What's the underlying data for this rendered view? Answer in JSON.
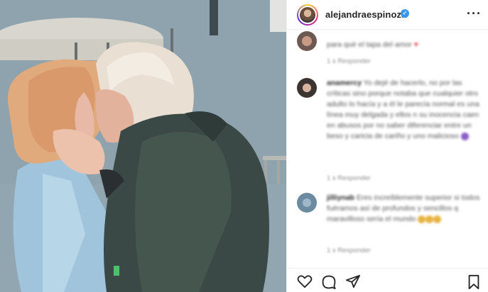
{
  "post": {
    "username": "alejandraespinoza",
    "verified": true,
    "more_icon": "more-horizontal-icon"
  },
  "comments": [
    {
      "text": "para qué el tapa del amor",
      "emoji_after": "heart",
      "meta": "1 s   Responder"
    },
    {
      "username": "anamercy",
      "text": "Yo dejé de hacerlo, no por las críticas sino porque notaba que cualquier otro adulto lo hacía y a él le parecía normal  es una línea muy delgada y ellos n su inocencia caen en abusos por no saber diferenciar entre un beso y caricia de cariño y uno malicioso",
      "meta": "1 s   Responder"
    },
    {
      "username": "jilliynab",
      "text": "Eres increíblemente superior  si todos fuéramos así de profundos y sencillos q maravilloso sería el mundo",
      "meta": "1 s   Responder"
    }
  ],
  "actions": {
    "like_icon": "heart-icon",
    "comment_icon": "comment-icon",
    "share_icon": "share-icon",
    "save_icon": "bookmark-icon"
  },
  "colors": {
    "verified_badge": "#3897f0",
    "heart": "#ed4956",
    "text_primary": "#262626",
    "text_secondary": "#8e8e8e"
  }
}
